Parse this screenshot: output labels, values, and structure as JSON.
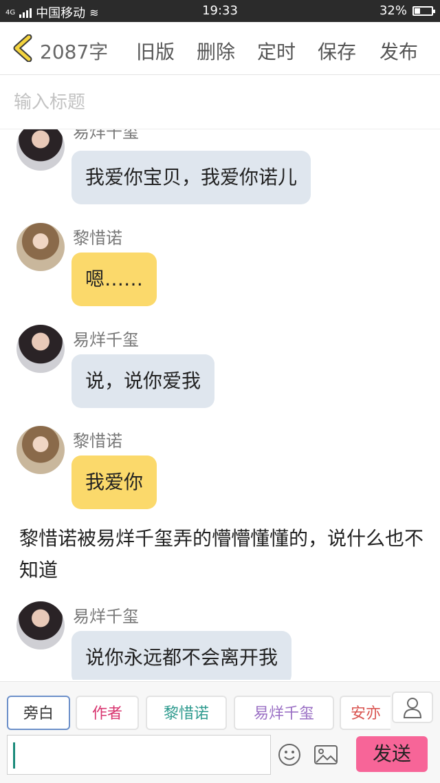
{
  "status": {
    "network": "4G",
    "carrier": "中国移动",
    "time": "19:33",
    "battery": "32%",
    "battery_level": 0.32
  },
  "toolbar": {
    "word_count": "2087字",
    "old_version": "旧版",
    "delete": "删除",
    "schedule": "定时",
    "save": "保存",
    "publish": "发布"
  },
  "title_input": {
    "placeholder": "输入标题",
    "value": ""
  },
  "messages": [
    {
      "sender": "易烊千玺",
      "text": "我爱你宝贝，我爱你诺儿",
      "style": "blue"
    },
    {
      "sender": "黎惜诺",
      "text": "嗯……",
      "style": "yellow"
    },
    {
      "sender": "易烊千玺",
      "text": "说，说你爱我",
      "style": "blue"
    },
    {
      "sender": "黎惜诺",
      "text": "我爱你",
      "style": "yellow"
    },
    {
      "sender": "易烊千玺",
      "text": "说你永远都不会离开我",
      "style": "blue"
    }
  ],
  "narration": "黎惜诺被易烊千玺弄的懵懵懂懂的，说什么也不知道",
  "roles": [
    {
      "label": "旁白",
      "color": "#333333"
    },
    {
      "label": "作者",
      "color": "#d8346f"
    },
    {
      "label": "黎惜诺",
      "color": "#2f9b8f"
    },
    {
      "label": "易烊千玺",
      "color": "#9a6fc4"
    },
    {
      "label": "安亦",
      "color": "#d9534f"
    }
  ],
  "composer": {
    "value": "",
    "send_label": "发送"
  }
}
